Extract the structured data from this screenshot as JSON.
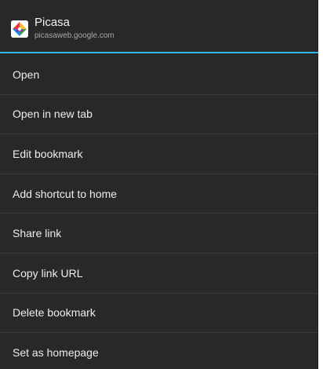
{
  "header": {
    "title": "Picasa",
    "subtitle": "picasaweb.google.com",
    "icon": "picasa-icon"
  },
  "colors": {
    "background": "#282828",
    "accent_divider": "#33b5e5",
    "divider": "#3a3a3a",
    "text": "#ededed",
    "subtext": "#a8a8a8"
  },
  "menu": {
    "items": [
      {
        "label": "Open"
      },
      {
        "label": "Open in new tab"
      },
      {
        "label": "Edit bookmark"
      },
      {
        "label": "Add shortcut to home"
      },
      {
        "label": "Share link"
      },
      {
        "label": "Copy link URL"
      },
      {
        "label": "Delete bookmark"
      },
      {
        "label": "Set as homepage"
      }
    ]
  }
}
